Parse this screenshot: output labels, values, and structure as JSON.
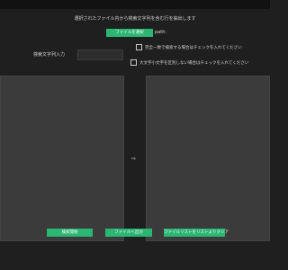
{
  "instruction": "選択されたファイル内から検索文字列を含む行を抽出します",
  "select_button": "ファイルを選択",
  "path_label": "path:",
  "search": {
    "label": "検索文字列入力",
    "value": "",
    "placeholder": ""
  },
  "options": {
    "exact": "完全一致で検索する場合はチェックを入れてください",
    "case": "大文字小文字を区別しない場合はチェックを入れてください"
  },
  "arrow": "⇨",
  "buttons": {
    "start": "検索開始",
    "output": "ファイルへ出力",
    "clear": "ファイルリストをリストよりクリア"
  },
  "colors": {
    "accent": "#2bb673",
    "background": "#1f1f1f",
    "panel": "#3b3b3b"
  }
}
